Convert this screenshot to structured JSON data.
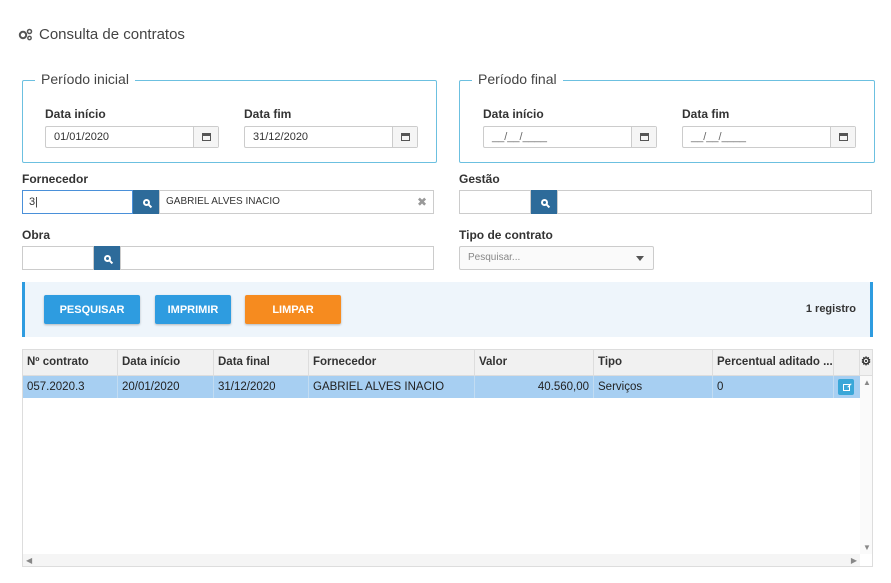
{
  "page": {
    "title": "Consulta de contratos",
    "icon": "gears-icon"
  },
  "periodo_inicial": {
    "legend": "Período inicial",
    "data_inicio_label": "Data início",
    "data_inicio_value": "01/01/2020",
    "data_fim_label": "Data fim",
    "data_fim_value": "31/12/2020"
  },
  "periodo_final": {
    "legend": "Período final",
    "data_inicio_label": "Data início",
    "data_inicio_value": "__/__/____",
    "data_fim_label": "Data fim",
    "data_fim_value": "__/__/____"
  },
  "fornecedor": {
    "label": "Fornecedor",
    "code": "3|",
    "name": "GABRIEL ALVES INACIO"
  },
  "gestao": {
    "label": "Gestão",
    "code": "",
    "name": ""
  },
  "obra": {
    "label": "Obra",
    "code": "",
    "name": ""
  },
  "tipo_contrato": {
    "label": "Tipo de contrato",
    "placeholder": "Pesquisar..."
  },
  "toolbar": {
    "pesquisar": "PESQUISAR",
    "imprimir": "IMPRIMIR",
    "limpar": "LIMPAR",
    "count": "1 registro"
  },
  "table": {
    "columns": [
      "Nº contrato",
      "Data início",
      "Data final",
      "Fornecedor",
      "Valor",
      "Tipo",
      "Percentual aditado ..."
    ],
    "rows": [
      [
        "057.2020.3",
        "20/01/2020",
        "31/12/2020",
        "GABRIEL ALVES INACIO",
        "40.560,00",
        "Serviços",
        "0"
      ]
    ]
  },
  "colors": {
    "accent": "#2e9ce0",
    "primary_btn": "#2e9ce0",
    "limpar_btn": "#f68b1f",
    "search_btn": "#2d6b9a",
    "selected_row": "#a7cff2"
  }
}
